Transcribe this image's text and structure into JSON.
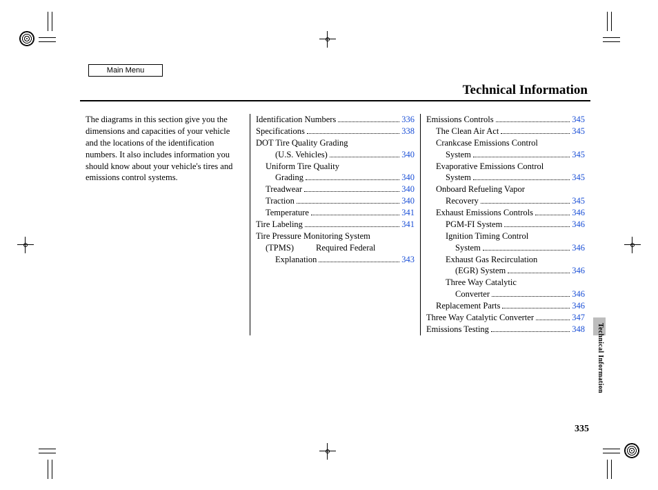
{
  "mainMenuLabel": "Main Menu",
  "title": "Technical Information",
  "sideLabel": "Technical Information",
  "pageNumber": "335",
  "intro": "The diagrams in this section give you the dimensions and capacities of your vehicle and the locations of the identification numbers. It also includes information you should know about your vehicle's tires and emissions control systems.",
  "col2": [
    {
      "t": "link",
      "label": "Identification Numbers",
      "page": "336",
      "indent": 0
    },
    {
      "t": "link",
      "label": "Specifications",
      "page": "338",
      "indent": 0
    },
    {
      "t": "head",
      "label": "DOT Tire Quality Grading",
      "indent": 0
    },
    {
      "t": "link",
      "label": "(U.S. Vehicles)",
      "page": "340",
      "indent": 2
    },
    {
      "t": "head",
      "label": "Uniform Tire Quality",
      "indent": 1
    },
    {
      "t": "link",
      "label": "Grading",
      "page": "340",
      "indent": 2
    },
    {
      "t": "link",
      "label": "Treadwear",
      "page": "340",
      "indent": 1
    },
    {
      "t": "link",
      "label": "Traction",
      "page": "340",
      "indent": 1
    },
    {
      "t": "link",
      "label": "Temperature",
      "page": "341",
      "indent": 1
    },
    {
      "t": "link",
      "label": "Tire Labeling",
      "page": "341",
      "indent": 0
    },
    {
      "t": "head",
      "label": "Tire Pressure Monitoring System",
      "indent": 0
    },
    {
      "t": "split",
      "label": "(TPMS)",
      "cont": "Required Federal",
      "indent": 1
    },
    {
      "t": "link",
      "label": "Explanation",
      "page": "343",
      "indent": 2
    }
  ],
  "col3": [
    {
      "t": "link",
      "label": "Emissions Controls",
      "page": "345",
      "indent": 0
    },
    {
      "t": "link",
      "label": "The Clean Air Act",
      "page": "345",
      "indent": 1
    },
    {
      "t": "head",
      "label": "Crankcase Emissions Control",
      "indent": 1
    },
    {
      "t": "link",
      "label": "System",
      "page": "345",
      "indent": 2
    },
    {
      "t": "head",
      "label": "Evaporative Emissions Control",
      "indent": 1
    },
    {
      "t": "link",
      "label": "System",
      "page": "345",
      "indent": 2
    },
    {
      "t": "head",
      "label": "Onboard Refueling Vapor",
      "indent": 1
    },
    {
      "t": "link",
      "label": "Recovery",
      "page": "345",
      "indent": 2
    },
    {
      "t": "link",
      "label": "Exhaust Emissions Controls",
      "page": "346",
      "indent": 1
    },
    {
      "t": "link",
      "label": "PGM-FI System",
      "page": "346",
      "indent": 2
    },
    {
      "t": "head",
      "label": "Ignition Timing Control",
      "indent": 2
    },
    {
      "t": "link",
      "label": "System",
      "page": "346",
      "indent": 3
    },
    {
      "t": "head",
      "label": "Exhaust Gas Recirculation",
      "indent": 2
    },
    {
      "t": "link",
      "label": "(EGR) System",
      "page": "346",
      "indent": 3
    },
    {
      "t": "head",
      "label": "Three Way Catalytic",
      "indent": 2
    },
    {
      "t": "link",
      "label": "Converter",
      "page": "346",
      "indent": 3
    },
    {
      "t": "link",
      "label": "Replacement Parts",
      "page": "346",
      "indent": 1
    },
    {
      "t": "link",
      "label": "Three Way Catalytic Converter",
      "page": "347",
      "indent": 0
    },
    {
      "t": "link",
      "label": "Emissions Testing",
      "page": "348",
      "indent": 0
    }
  ]
}
